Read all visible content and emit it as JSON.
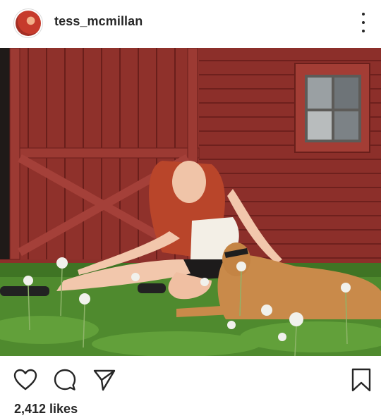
{
  "post": {
    "username": "tess_mcmillan",
    "likes_text": "2,412 likes"
  },
  "icons": {
    "avatar": "profile-avatar",
    "more": "more-options-icon",
    "like": "heart-icon",
    "comment": "comment-icon",
    "share": "send-icon",
    "save": "bookmark-icon"
  },
  "colors": {
    "text": "#262626",
    "barn_red": "#8a2f2a",
    "grass": "#4f8a2e"
  }
}
